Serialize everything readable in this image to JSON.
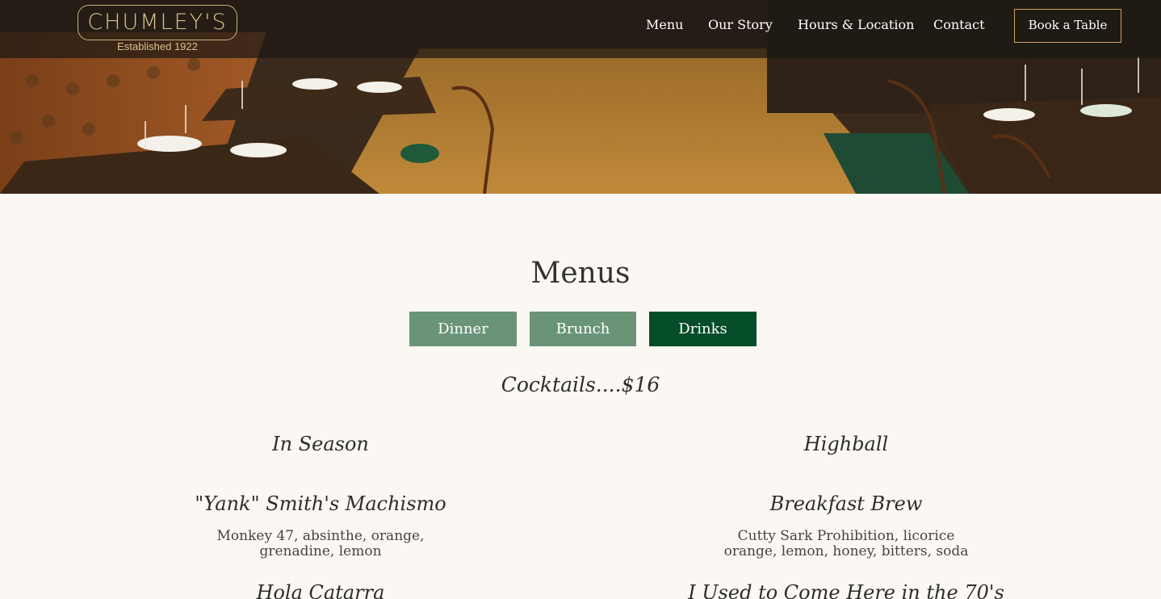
{
  "header": {
    "logo_text": "CHUMLEY'S",
    "logo_subtitle": "Established 1922",
    "nav": [
      "Menu",
      "Our Story",
      "Hours & Location",
      "Contact"
    ],
    "book_label": "Book a Table"
  },
  "main": {
    "title": "Menus",
    "tabs": [
      {
        "label": "Dinner",
        "active": false
      },
      {
        "label": "Brunch",
        "active": false
      },
      {
        "label": "Drinks",
        "active": true
      }
    ],
    "section_title": "Cocktails....$16",
    "columns": [
      {
        "heading": "In Season",
        "items": [
          {
            "name": "\"Yank\" Smith's Machismo",
            "desc_lines": [
              "Monkey 47, absinthe, orange,",
              "grenadine, lemon"
            ]
          },
          {
            "name": "Hola Catarra"
          }
        ]
      },
      {
        "heading": "Highball",
        "items": [
          {
            "name": "Breakfast Brew",
            "desc_lines": [
              "Cutty Sark Prohibition, licorice",
              "orange, lemon, honey, bitters, soda"
            ]
          },
          {
            "name": "I Used to Come Here in the 70's"
          }
        ]
      }
    ]
  },
  "colors": {
    "tab_inactive": "#6a9478",
    "tab_active": "#044d28",
    "book_border": "#c9a25a",
    "logo_gold": "#d8c38a",
    "page_bg": "#fbf8f3"
  }
}
